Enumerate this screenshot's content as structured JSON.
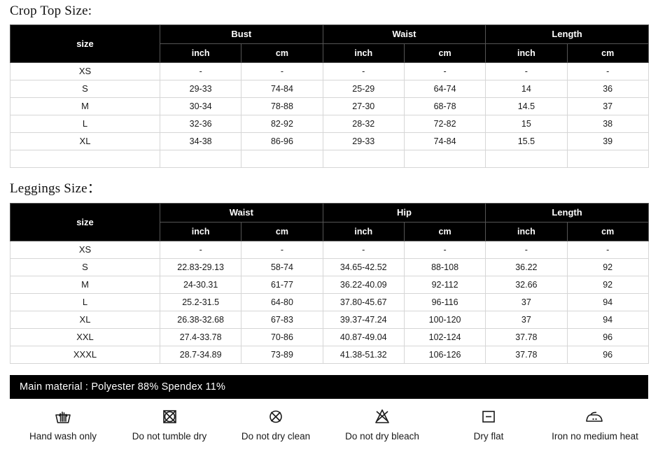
{
  "sections": {
    "crop_top": {
      "title": "Crop Top Size:",
      "table": {
        "size_header": "size",
        "groups": [
          {
            "label": "Bust",
            "units": [
              "inch",
              "cm"
            ]
          },
          {
            "label": "Waist",
            "units": [
              "inch",
              "cm"
            ]
          },
          {
            "label": "Length",
            "units": [
              "inch",
              "cm"
            ]
          }
        ],
        "rows": [
          {
            "size": "XS",
            "values": [
              "-",
              "-",
              "-",
              "-",
              "-",
              "-"
            ]
          },
          {
            "size": "S",
            "values": [
              "29-33",
              "74-84",
              "25-29",
              "64-74",
              "14",
              "36"
            ]
          },
          {
            "size": "M",
            "values": [
              "30-34",
              "78-88",
              "27-30",
              "68-78",
              "14.5",
              "37"
            ]
          },
          {
            "size": "L",
            "values": [
              "32-36",
              "82-92",
              "28-32",
              "72-82",
              "15",
              "38"
            ]
          },
          {
            "size": "XL",
            "values": [
              "34-38",
              "86-96",
              "29-33",
              "74-84",
              "15.5",
              "39"
            ]
          },
          {
            "size": "",
            "values": [
              "",
              "",
              "",
              "",
              "",
              ""
            ]
          }
        ]
      }
    },
    "leggings": {
      "title": "Leggings Size：",
      "table": {
        "size_header": "size",
        "groups": [
          {
            "label": "Waist",
            "units": [
              "inch",
              "cm"
            ]
          },
          {
            "label": "Hip",
            "units": [
              "inch",
              "cm"
            ]
          },
          {
            "label": "Length",
            "units": [
              "inch",
              "cm"
            ]
          }
        ],
        "rows": [
          {
            "size": "XS",
            "values": [
              "-",
              "-",
              "-",
              "-",
              "-",
              "-"
            ]
          },
          {
            "size": "S",
            "values": [
              "22.83-29.13",
              "58-74",
              "34.65-42.52",
              "88-108",
              "36.22",
              "92"
            ]
          },
          {
            "size": "M",
            "values": [
              "24-30.31",
              "61-77",
              "36.22-40.09",
              "92-112",
              "32.66",
              "92"
            ]
          },
          {
            "size": "L",
            "values": [
              "25.2-31.5",
              "64-80",
              "37.80-45.67",
              "96-116",
              "37",
              "94"
            ]
          },
          {
            "size": "XL",
            "values": [
              "26.38-32.68",
              "67-83",
              "39.37-47.24",
              "100-120",
              "37",
              "94"
            ]
          },
          {
            "size": "XXL",
            "values": [
              "27.4-33.78",
              "70-86",
              "40.87-49.04",
              "102-124",
              "37.78",
              "96"
            ]
          },
          {
            "size": "XXXL",
            "values": [
              "28.7-34.89",
              "73-89",
              "41.38-51.32",
              "106-126",
              "37.78",
              "96"
            ]
          }
        ]
      }
    }
  },
  "material_banner": {
    "text": "Main material : Polyester 88% Spendex 11%"
  },
  "care_instructions": [
    {
      "icon": "hand-wash-icon",
      "label": "Hand wash only"
    },
    {
      "icon": "no-tumble-dry-icon",
      "label": "Do not tumble dry"
    },
    {
      "icon": "no-dry-clean-icon",
      "label": "Do not dry clean"
    },
    {
      "icon": "no-bleach-icon",
      "label": "Do not dry bleach"
    },
    {
      "icon": "dry-flat-icon",
      "label": "Dry flat"
    },
    {
      "icon": "iron-medium-heat-icon",
      "label": "Iron no medium heat"
    }
  ],
  "colors": {
    "header_bg": "#000000",
    "header_text": "#ffffff",
    "page_bg": "#ffffff",
    "grid_line": "#d6d6d6",
    "body_text": "#1a1a1a"
  }
}
